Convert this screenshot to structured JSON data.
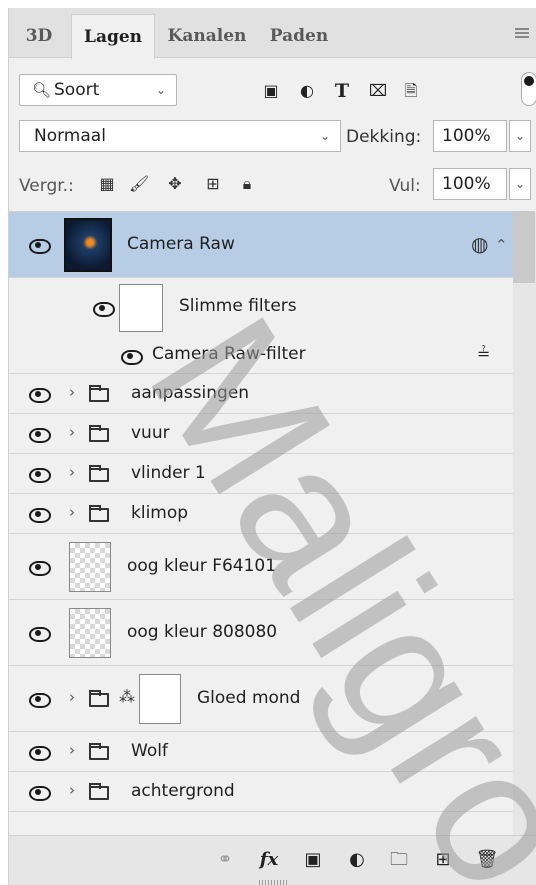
{
  "tabs": [
    {
      "label": "3D",
      "active": false
    },
    {
      "label": "Lagen",
      "active": true
    },
    {
      "label": "Kanalen",
      "active": false
    },
    {
      "label": "Paden",
      "active": false
    }
  ],
  "panel_menu_icon": "hamburger-menu-icon",
  "filter": {
    "kind_label": "Soort",
    "icons": [
      "pixel-layer-filter-icon",
      "adjustment-layer-filter-icon",
      "type-layer-filter-icon",
      "shape-layer-filter-icon",
      "smart-object-filter-icon"
    ],
    "type_glyph": "T"
  },
  "blend": {
    "mode": "Normaal",
    "opacity_label": "Dekking:",
    "opacity_value": "100%"
  },
  "lock": {
    "label": "Vergr.:",
    "fill_label": "Vul:",
    "fill_value": "100%"
  },
  "layers": [
    {
      "name": "Camera Raw",
      "type": "smart-object",
      "selected": true
    },
    {
      "name": "Slimme filters",
      "type": "smart-filters"
    },
    {
      "name": "Camera Raw-filter",
      "type": "filter"
    },
    {
      "name": "aanpassingen",
      "type": "group"
    },
    {
      "name": "vuur",
      "type": "group"
    },
    {
      "name": "vlinder 1",
      "type": "group"
    },
    {
      "name": "klimop",
      "type": "group"
    },
    {
      "name": "oog kleur F64101",
      "type": "pixel"
    },
    {
      "name": "oog kleur  808080",
      "type": "pixel"
    },
    {
      "name": "Gloed mond",
      "type": "group-masked"
    },
    {
      "name": "Wolf",
      "type": "group"
    },
    {
      "name": "achtergrond",
      "type": "group"
    }
  ],
  "bottom_icons": [
    "link-layers-icon",
    "fx-icon",
    "layer-mask-icon",
    "adjustment-layer-icon",
    "new-group-icon",
    "new-layer-icon",
    "trash-icon"
  ],
  "fx_label": "fx",
  "watermark_text": "Maligro",
  "accent_color": "#b7cde6"
}
